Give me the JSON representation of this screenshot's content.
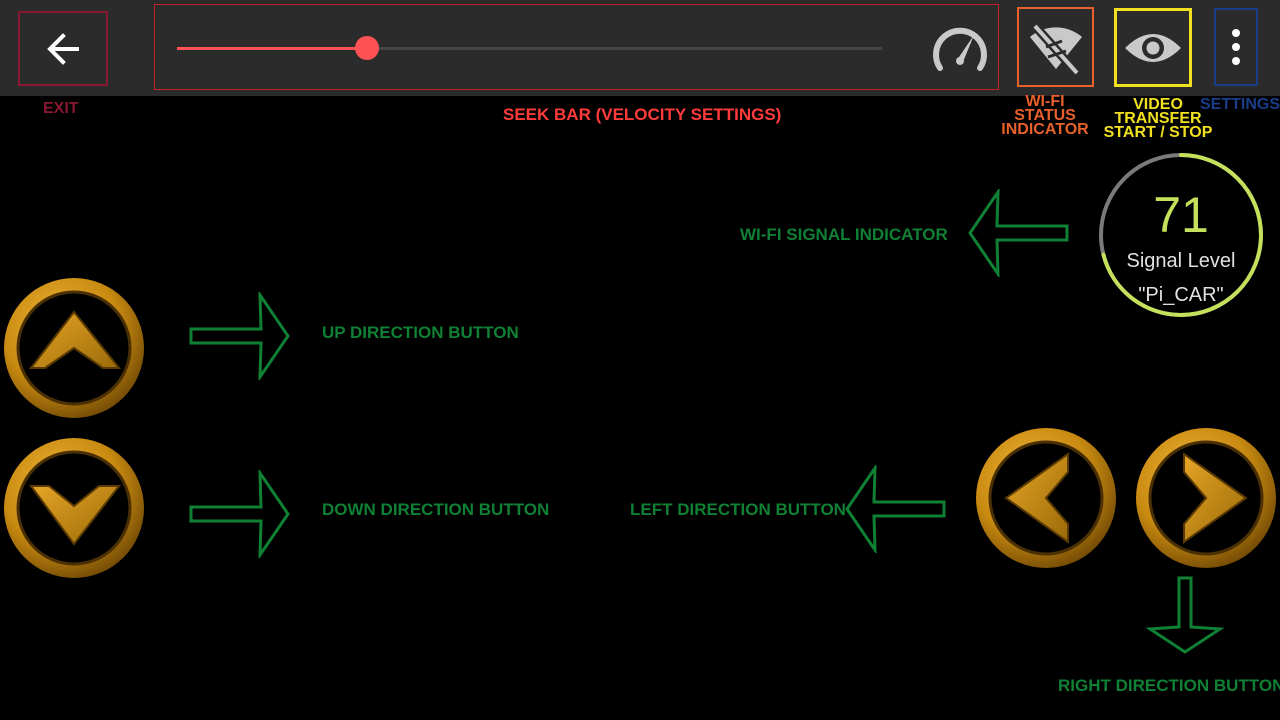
{
  "toolbar": {
    "exit_icon": "arrow-back-icon",
    "seekbar": {
      "value_fraction": 0.27
    },
    "speed_icon": "speedometer-icon",
    "wifi_icon": "wifi-off-icon",
    "video_icon": "eye-icon",
    "settings_icon": "more-vert-icon"
  },
  "labels": {
    "exit": "EXIT",
    "seek": "SEEK BAR (VELOCITY SETTINGS)",
    "wifi_status": [
      "WI-FI",
      "STATUS",
      "INDICATOR"
    ],
    "video": [
      "VIDEO",
      "TRANSFER",
      "START / STOP"
    ],
    "settings": "SETTINGS",
    "wifi_signal": "WI-FI SIGNAL INDICATOR",
    "up": "UP DIRECTION BUTTON",
    "down": "DOWN DIRECTION BUTTON",
    "left": "LEFT DIRECTION BUTTON",
    "right": "RIGHT DIRECTION BUTTON"
  },
  "signal": {
    "value": "71",
    "title": "Signal Level",
    "ssid": "\"Pi_CAR\"",
    "fraction": 0.71
  },
  "colors": {
    "exit": "#8a1830",
    "seek": "#ff3b3b",
    "wifi_status": "#e8612a",
    "video": "#f0e020",
    "settings": "#1a3d8a",
    "annotation": "#0f8034",
    "gauge_value": "#c5e05a",
    "button_gold": "#c88a10"
  }
}
